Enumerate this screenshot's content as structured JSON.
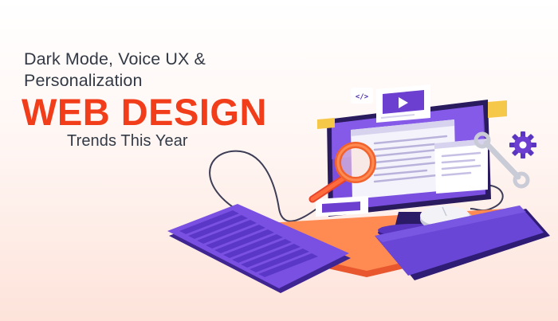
{
  "headline": {
    "line1": "Dark Mode, Voice UX &",
    "line2": "Personalization",
    "line3": "WEB DESIGN",
    "line4": "Trends This Year"
  },
  "icons": [
    "code-icon",
    "video-play-icon",
    "magnifier-icon",
    "wrench-icon",
    "gear-icon"
  ],
  "colors": {
    "accent": "#f23d1b",
    "text": "#333a45",
    "purple": "#6c3fd1",
    "purple_dark": "#3b1e8c",
    "orange": "#f06a3c",
    "yellow": "#f6c84a",
    "background": "#fde3da"
  }
}
